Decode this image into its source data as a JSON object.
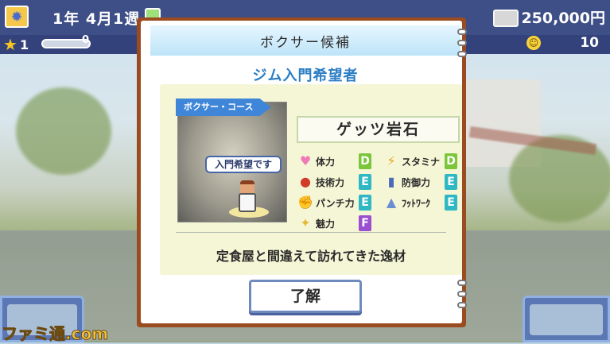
{
  "header": {
    "date": "1年  4月1週",
    "money": "250,000円",
    "level": "1",
    "exp_value": "0",
    "fans": "10"
  },
  "dialog": {
    "title": "ボクサー候補",
    "subtitle": "ジム入門希望者",
    "course_label": "ボクサー・コース",
    "speech": "入門希望です",
    "boxer_name": "ゲッツ岩石",
    "stats": [
      {
        "label": "体力",
        "grade": "D",
        "icon": "heart-icon",
        "color": "#7bc63a"
      },
      {
        "label": "スタミナ",
        "grade": "D",
        "icon": "lightning-icon",
        "color": "#7bc63a"
      },
      {
        "label": "技術力",
        "grade": "E",
        "icon": "glove-icon",
        "color": "#2fb8c4"
      },
      {
        "label": "防御力",
        "grade": "E",
        "icon": "guard-icon",
        "color": "#2fb8c4"
      },
      {
        "label": "パンチ力",
        "grade": "E",
        "icon": "arm-icon",
        "color": "#2fb8c4"
      },
      {
        "label": "ﾌｯﾄﾜｰｸ",
        "grade": "E",
        "icon": "shoe-icon",
        "color": "#2fb8c4"
      },
      {
        "label": "魅力",
        "grade": "F",
        "icon": "charm-icon",
        "color": "#9a4fd1"
      }
    ],
    "description": "定食屋と間違えて訪れてきた逸材",
    "ok_label": "了解"
  },
  "watermark": "ファミ通.com"
}
